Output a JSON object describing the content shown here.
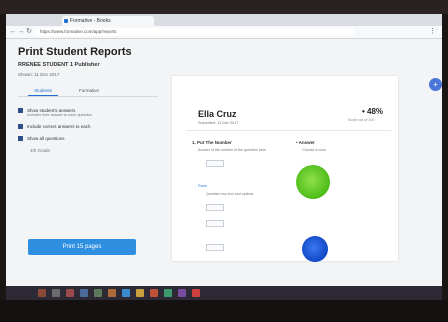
{
  "browser": {
    "tab_title": "Formative - Books",
    "tab_close": "×",
    "url": "https://www.formative.com/app/reports",
    "back_icon": "back-arrow-icon",
    "forward_icon": "forward-arrow-icon",
    "reload_icon": "reload-icon",
    "menu_icon": "more-vert-icon"
  },
  "left": {
    "title": "Print Student Reports",
    "subtitle": "RRENEE STUDENT 1 Publisher",
    "meta": "Shown: 11 Dec 2017",
    "tabs": [
      "Students",
      "Formative"
    ],
    "options": [
      {
        "label": "Show student's answers",
        "note": "Includes their answer to each question"
      },
      {
        "label": "Include correct answers to each"
      },
      {
        "label": "Show all questions"
      }
    ],
    "student_note": "4th Grade",
    "print_button": "Print 15 pages"
  },
  "report": {
    "student_name": "Ella Cruz",
    "date": "Submitted: 11 Dec 2017",
    "score": "• 48%",
    "score_sub": "Score out of 100",
    "q1_head": "1. Put The Number",
    "q1_line": "Answer of the number of the question here",
    "q2_head": "Parts",
    "q2_line": "Question two text and options",
    "right_head": "• Answer",
    "right_sub": "Choose a color"
  },
  "colors": {
    "accent": "#2e8fe0",
    "green_answer": "#4cbc18",
    "blue_answer": "#1148c6"
  }
}
